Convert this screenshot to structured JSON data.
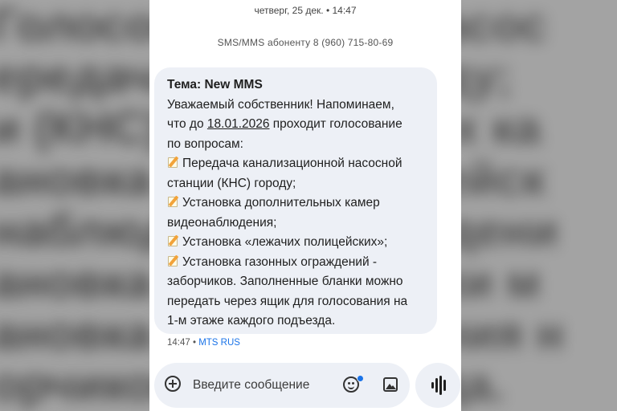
{
  "conversation": {
    "date_header": "четверг, 25 дек. • 14:47",
    "sms_info": "SMS/MMS абоненту 8 (960) 715-80-69"
  },
  "message": {
    "subject": "Тема: New MMS",
    "lines": [
      "Уважаемый собственник! Напоминаем,",
      "что до ",
      "18.01.2026",
      " проходит голосование",
      "по вопросам:",
      "Передача канализационной насосной",
      "станции (КНС) городу;",
      "Установка дополнительных камер",
      "видеонаблюдения;",
      "Установка «лежачих полицейских»;",
      "Установка газонных ограждений -",
      "заборчиков. Заполненные бланки можно",
      "передать через ящик для голосования на",
      "1-м этаже каждого подъезда."
    ],
    "time": "14:47 •",
    "carrier": "MTS RUS"
  },
  "compose": {
    "placeholder": "Введите сообщение"
  },
  "icons": {
    "memo": "memo-emoji-icon",
    "add": "add-circle-icon",
    "emoji": "emoji-icon",
    "gallery": "gallery-icon",
    "voice": "voice-waveform-icon"
  },
  "colors": {
    "bubble": "#edf0f6",
    "accent": "#1a73e8"
  }
}
